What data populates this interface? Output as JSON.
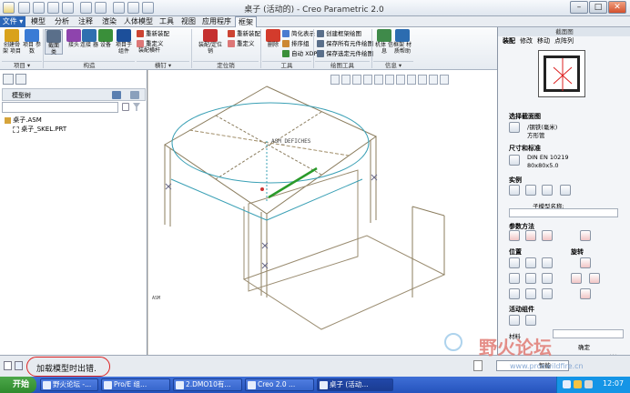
{
  "titlebar": {
    "title": "桌子 (活动的) - Creo Parametric 2.0",
    "minimize": "–",
    "maximize": "□",
    "close": "✕"
  },
  "menu_tabs": [
    "文件 ▾",
    "模型",
    "分析",
    "注释",
    "渲染",
    "人体模型",
    "工具",
    "视图",
    "应用程序",
    "框架"
  ],
  "ribbon": {
    "buttons": [
      {
        "label": "创建骨架 项目",
        "color": "#d9a21b"
      },
      {
        "label": "项目 参数",
        "color": "#3a7bd5"
      },
      {
        "label": "截面 类",
        "color": "#5a6f8a"
      },
      {
        "label": "接头",
        "color": "#8e44ad"
      },
      {
        "label": "连接 器",
        "color": "#2f6fb0"
      },
      {
        "label": "设备",
        "color": "#3a8f3a"
      },
      {
        "label": "项目于 组件",
        "color": "#1c4f9a"
      },
      {
        "label": "装配横杆",
        "color": "#8a5a2a"
      },
      {
        "label": "装配/定位销",
        "color": "#c53030"
      },
      {
        "label": "删除",
        "color": "#d33b2c"
      },
      {
        "label": "机体 信息",
        "color": "#3f8a4a"
      },
      {
        "label": "框架 材质帮助",
        "color": "#2c6cb0"
      }
    ],
    "small_items": {
      "assembly": [
        "重新装配",
        "重定义",
        ""
      ],
      "positions": [
        "重新装配",
        "重定义",
        ""
      ],
      "tools": [
        "简化表示",
        "排序组",
        "自动 XDP"
      ],
      "drawing": [
        "创建框架绘图",
        "保存所有元件绘图",
        "保存选定元件绘图"
      ]
    },
    "groups": [
      "项目 ▾",
      "构造",
      "横钉 ▾",
      "定位销",
      "工具",
      "绘图工具",
      "信息 ▾"
    ]
  },
  "navigator": {
    "tree_header": "模型树",
    "search_placeholder": "",
    "items": [
      "桌子.ASM",
      "桌子_SKEL.PRT"
    ]
  },
  "graphics": {
    "label_center": "ASM_DEFICHES",
    "label_corner": "ASM"
  },
  "right_panel": {
    "title": "截面图",
    "tabs": [
      "装配",
      "修改",
      "移动",
      "点阵列"
    ],
    "select_section": "选择截面图",
    "material": "/钢铁(毫米)",
    "shape": "方形管",
    "dimension_title": "尺寸和标准",
    "dimension_std": "DIN EN 10219",
    "dimension_size": "80x80x5.0",
    "instance_title": "实例",
    "sub_name_label": "子模型名称:",
    "reference_title": "参数方法",
    "position_title": "位置",
    "rotation_title": "旋转",
    "move_title": "活动组件",
    "material_label": "材料",
    "close_label": "关闭",
    "ok_label": "确定"
  },
  "status": {
    "message": "加载模型时出错.",
    "filter": "智能"
  },
  "watermark": {
    "text": "野火论坛",
    "url": "www.proewildfire.cn"
  },
  "taskbar": {
    "start": "开始",
    "tasks": [
      "野火论坛 -...",
      "Pro/E 组...",
      "2.DMO10有...",
      "Creo 2.0 ...",
      "桌子 (活动..."
    ],
    "time": "12:07"
  }
}
